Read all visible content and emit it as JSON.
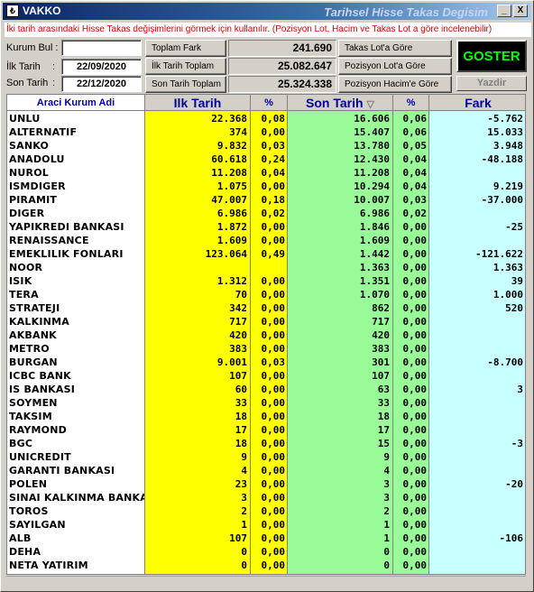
{
  "window": {
    "app_name": "VAKKO",
    "title": "Tarihsel Hisse Takas Degisim",
    "app_icon": "chart-icon",
    "buttons": {
      "minimize": "_",
      "maximize": "□",
      "close": "X"
    }
  },
  "info_text": "İki tarih arasındaki Hisse Takas değişimlerini görmek için kullanılır. (Pozisyon Lot, Hacim ve Takas Lot a göre incelenebilir)",
  "filters": {
    "kurum_bul_label": "Kurum Bul :",
    "kurum_bul_value": "",
    "ilk_tarih_label": "İlk Tarih",
    "ilk_tarih_value": "22/09/2020",
    "son_tarih_label": "Son Tarih",
    "son_tarih_value": "22/12/2020",
    "colon": ":"
  },
  "totals": {
    "toplam_fark_label": "Toplam Fark",
    "toplam_fark_value": "241.690",
    "ilk_tarih_toplam_label": "İlk Tarih Toplam",
    "ilk_tarih_toplam_value": "25.082.647",
    "son_tarih_toplam_label": "Son Tarih Toplam",
    "son_tarih_toplam_value": "25.324.338"
  },
  "modes": {
    "takas_lot": "Takas Lot'a Göre",
    "pozisyon_lot": "Pozisyon Lot'a Göre",
    "pozisyon_hacim": "Pozisyon Hacim'e Göre"
  },
  "actions": {
    "goster": "GOSTER",
    "yazdir": "Yazdir"
  },
  "columns": {
    "name": "Araci Kurum Adi",
    "ilk": "Ilk Tarih",
    "pct1": "%",
    "son": "Son Tarih",
    "pct2": "%",
    "fark": "Fark"
  },
  "colors": {
    "ilk_col": "#ffff00",
    "son_col": "#98fb98",
    "fark_col": "#c8ffff"
  },
  "rows": [
    {
      "name": "UNLU",
      "ilk": "22.368",
      "p1": "0,08",
      "son": "16.606",
      "p2": "0,06",
      "fark": "-5.762"
    },
    {
      "name": "ALTERNATIF",
      "ilk": "374",
      "p1": "0,00",
      "son": "15.407",
      "p2": "0,06",
      "fark": "15.033"
    },
    {
      "name": "SANKO",
      "ilk": "9.832",
      "p1": "0,03",
      "son": "13.780",
      "p2": "0,05",
      "fark": "3.948"
    },
    {
      "name": "ANADOLU",
      "ilk": "60.618",
      "p1": "0,24",
      "son": "12.430",
      "p2": "0,04",
      "fark": "-48.188"
    },
    {
      "name": "NUROL",
      "ilk": "11.208",
      "p1": "0,04",
      "son": "11.208",
      "p2": "0,04",
      "fark": ""
    },
    {
      "name": "ISMDIGER",
      "ilk": "1.075",
      "p1": "0,00",
      "son": "10.294",
      "p2": "0,04",
      "fark": "9.219"
    },
    {
      "name": "PIRAMIT",
      "ilk": "47.007",
      "p1": "0,18",
      "son": "10.007",
      "p2": "0,03",
      "fark": "-37.000"
    },
    {
      "name": "DIGER",
      "ilk": "6.986",
      "p1": "0,02",
      "son": "6.986",
      "p2": "0,02",
      "fark": ""
    },
    {
      "name": "YAPIKREDI BANKASI",
      "ilk": "1.872",
      "p1": "0,00",
      "son": "1.846",
      "p2": "0,00",
      "fark": "-25"
    },
    {
      "name": "RENAISSANCE",
      "ilk": "1.609",
      "p1": "0,00",
      "son": "1.609",
      "p2": "0,00",
      "fark": ""
    },
    {
      "name": "EMEKLILIK FONLARI",
      "ilk": "123.064",
      "p1": "0,49",
      "son": "1.442",
      "p2": "0,00",
      "fark": "-121.622"
    },
    {
      "name": "NOOR",
      "ilk": "",
      "p1": "",
      "son": "1.363",
      "p2": "0,00",
      "fark": "1.363"
    },
    {
      "name": "ISIK",
      "ilk": "1.312",
      "p1": "0,00",
      "son": "1.351",
      "p2": "0,00",
      "fark": "39"
    },
    {
      "name": "TERA",
      "ilk": "70",
      "p1": "0,00",
      "son": "1.070",
      "p2": "0,00",
      "fark": "1.000"
    },
    {
      "name": "STRATEJI",
      "ilk": "342",
      "p1": "0,00",
      "son": "862",
      "p2": "0,00",
      "fark": "520"
    },
    {
      "name": "KALKINMA",
      "ilk": "717",
      "p1": "0,00",
      "son": "717",
      "p2": "0,00",
      "fark": ""
    },
    {
      "name": "AKBANK",
      "ilk": "420",
      "p1": "0,00",
      "son": "420",
      "p2": "0,00",
      "fark": ""
    },
    {
      "name": "METRO",
      "ilk": "383",
      "p1": "0,00",
      "son": "383",
      "p2": "0,00",
      "fark": ""
    },
    {
      "name": "BURGAN",
      "ilk": "9.001",
      "p1": "0,03",
      "son": "301",
      "p2": "0,00",
      "fark": "-8.700"
    },
    {
      "name": "ICBC BANK",
      "ilk": "107",
      "p1": "0,00",
      "son": "107",
      "p2": "0,00",
      "fark": ""
    },
    {
      "name": "IS BANKASI",
      "ilk": "60",
      "p1": "0,00",
      "son": "63",
      "p2": "0,00",
      "fark": "3"
    },
    {
      "name": "SOYMEN",
      "ilk": "33",
      "p1": "0,00",
      "son": "33",
      "p2": "0,00",
      "fark": ""
    },
    {
      "name": "TAKSIM",
      "ilk": "18",
      "p1": "0,00",
      "son": "18",
      "p2": "0,00",
      "fark": ""
    },
    {
      "name": "RAYMOND",
      "ilk": "17",
      "p1": "0,00",
      "son": "17",
      "p2": "0,00",
      "fark": ""
    },
    {
      "name": "BGC",
      "ilk": "18",
      "p1": "0,00",
      "son": "15",
      "p2": "0,00",
      "fark": "-3"
    },
    {
      "name": "UNICREDIT",
      "ilk": "9",
      "p1": "0,00",
      "son": "9",
      "p2": "0,00",
      "fark": ""
    },
    {
      "name": "GARANTI BANKASI",
      "ilk": "4",
      "p1": "0,00",
      "son": "4",
      "p2": "0,00",
      "fark": ""
    },
    {
      "name": "POLEN",
      "ilk": "23",
      "p1": "0,00",
      "son": "3",
      "p2": "0,00",
      "fark": "-20"
    },
    {
      "name": "SINAI KALKINMA BANKASI",
      "ilk": "3",
      "p1": "0,00",
      "son": "3",
      "p2": "0,00",
      "fark": ""
    },
    {
      "name": "TOROS",
      "ilk": "2",
      "p1": "0,00",
      "son": "2",
      "p2": "0,00",
      "fark": ""
    },
    {
      "name": "SAYILGAN",
      "ilk": "1",
      "p1": "0,00",
      "son": "1",
      "p2": "0,00",
      "fark": ""
    },
    {
      "name": "ALB",
      "ilk": "107",
      "p1": "0,00",
      "son": "1",
      "p2": "0,00",
      "fark": "-106"
    },
    {
      "name": "DEHA",
      "ilk": "0",
      "p1": "0,00",
      "son": "0",
      "p2": "0,00",
      "fark": ""
    },
    {
      "name": "NETA YATIRIM",
      "ilk": "0",
      "p1": "0,00",
      "son": "0",
      "p2": "0,00",
      "fark": ""
    }
  ]
}
